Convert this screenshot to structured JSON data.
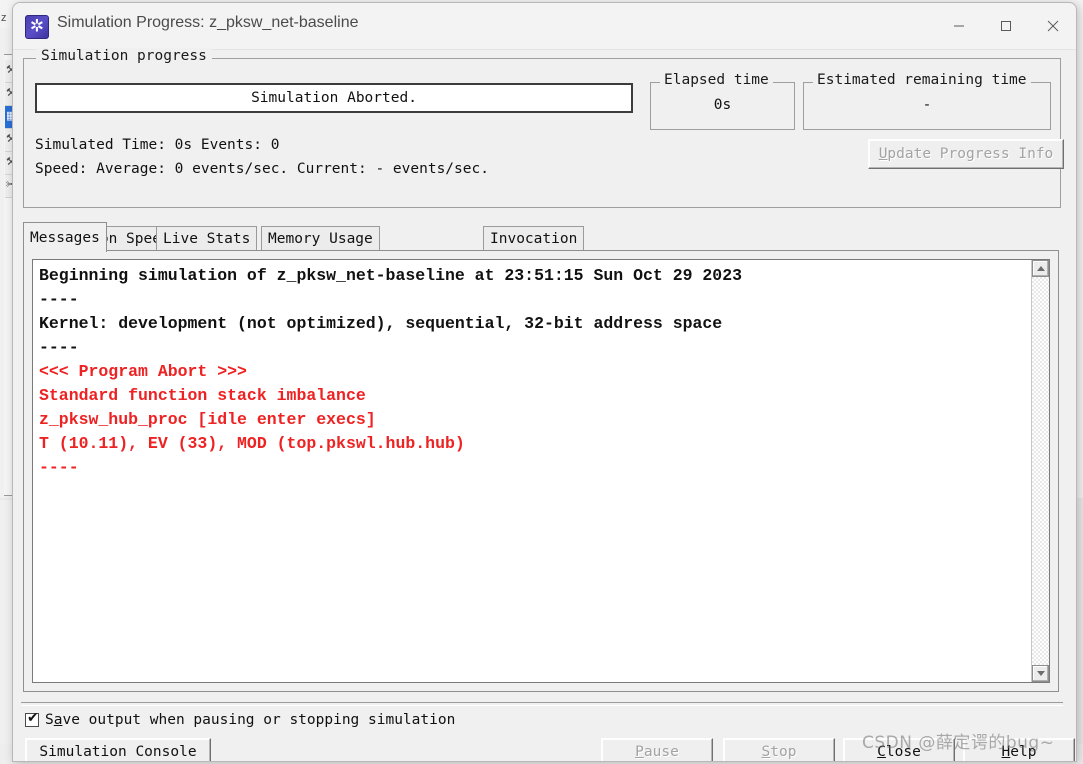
{
  "background": {
    "tab_label": "z",
    "sidebar_items": [
      {
        "icon": "wrench-icon",
        "selected": false
      },
      {
        "icon": "wrench-icon",
        "selected": false
      },
      {
        "icon": "module-icon",
        "selected": true
      },
      {
        "icon": "wrench-icon",
        "selected": false
      },
      {
        "icon": "wrench-icon",
        "selected": false
      },
      {
        "icon": "tool-icon",
        "selected": false
      }
    ]
  },
  "window": {
    "title": "Simulation Progress: z_pksw_net-baseline",
    "icon": "omnet-burst-icon",
    "controls": {
      "minimize": "minimize-icon",
      "maximize": "maximize-icon",
      "close": "close-icon"
    }
  },
  "progress_group": {
    "legend": "Simulation progress",
    "progress_text": "Simulation Aborted.",
    "simulated_time_line": "Simulated Time: 0s Events: 0",
    "speed_line": "Speed: Average: 0 events/sec. Current: - events/sec.",
    "elapsed": {
      "legend": "Elapsed time",
      "value": "0s"
    },
    "remaining": {
      "legend": "Estimated remaining time",
      "value": "-"
    },
    "update_button": {
      "label": "Update Progress Info",
      "mnemonic": "U",
      "enabled": false
    }
  },
  "tabs": [
    {
      "label": "Simulation Speed",
      "active": false
    },
    {
      "label": "Live Stats",
      "active": false
    },
    {
      "label": "Memory Usage",
      "active": false
    },
    {
      "label": "Messages",
      "active": true
    },
    {
      "label": "Invocation",
      "active": false
    }
  ],
  "log": {
    "lines": [
      {
        "text": "Beginning simulation of z_pksw_net-baseline at 23:51:15 Sun Oct 29 2023",
        "color": "black"
      },
      {
        "text": "----",
        "color": "black"
      },
      {
        "text": "Kernel: development (not optimized), sequential, 32-bit address space",
        "color": "black"
      },
      {
        "text": "----",
        "color": "black"
      },
      {
        "text": "<<< Program Abort >>>",
        "color": "red"
      },
      {
        "text": "Standard function stack imbalance",
        "color": "red"
      },
      {
        "text": "z_pksw_hub_proc [idle enter execs]",
        "color": "red"
      },
      {
        "text": "T (10.11), EV (33), MOD (top.pkswl.hub.hub)",
        "color": "red"
      },
      {
        "text": "----",
        "color": "red"
      }
    ],
    "colors": {
      "black": "#111111",
      "red": "#ee2222"
    },
    "scrollbar": {
      "up_icon": "scroll-up-arrow-icon",
      "down_icon": "scroll-down-arrow-icon"
    }
  },
  "footer": {
    "save_output_checkbox": {
      "label": "Save output when pausing or stopping simulation",
      "label_prefix": "S",
      "label_mnemonic": "a",
      "label_suffix": "ve output when pausing or stopping simulation",
      "checked": true,
      "check_glyph": "✔"
    },
    "buttons": {
      "console": {
        "label": "Simulation Console",
        "enabled": true
      },
      "pause": {
        "label": "Pause",
        "mnemonic": "P",
        "prefix": "",
        "suffix": "ause",
        "enabled": false
      },
      "stop": {
        "label": "Stop",
        "mnemonic": "S",
        "prefix": "",
        "suffix": "top",
        "enabled": false
      },
      "close": {
        "label": "Close",
        "mnemonic": "C",
        "prefix": "",
        "suffix": "lose",
        "enabled": true
      },
      "help": {
        "label": "Help",
        "mnemonic": "H",
        "prefix": "",
        "suffix": "elp",
        "enabled": true
      }
    }
  },
  "watermark": {
    "text": "CSDN @薛定谔的bug~"
  }
}
